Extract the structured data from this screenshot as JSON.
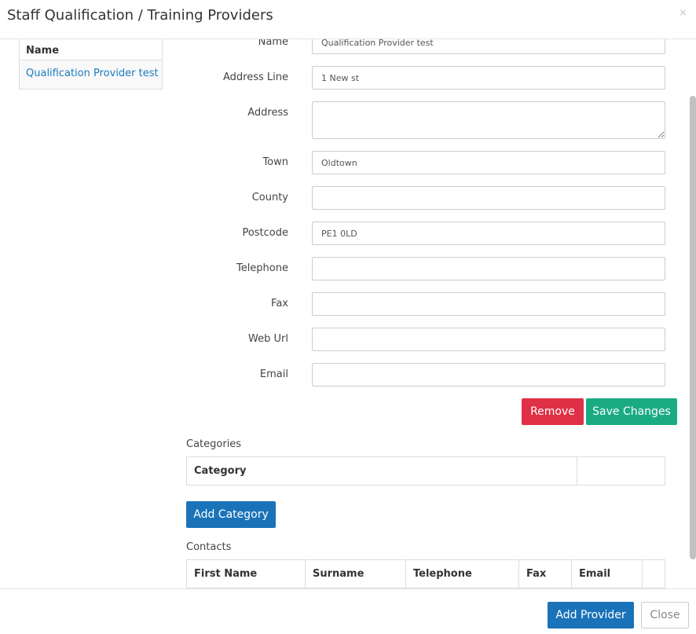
{
  "header": {
    "title": "Staff Qualification / Training Providers",
    "close_glyph": "×"
  },
  "provider_list": {
    "header": "Name",
    "items": [
      "Qualification Provider test"
    ]
  },
  "form": {
    "name": {
      "label": "Name",
      "value": "Qualification Provider test"
    },
    "address_line": {
      "label": "Address Line",
      "value": "1 New st"
    },
    "address": {
      "label": "Address",
      "value": ""
    },
    "town": {
      "label": "Town",
      "value": "Oldtown"
    },
    "county": {
      "label": "County",
      "value": ""
    },
    "postcode": {
      "label": "Postcode",
      "value": "PE1 0LD"
    },
    "telephone": {
      "label": "Telephone",
      "value": ""
    },
    "fax": {
      "label": "Fax",
      "value": ""
    },
    "web_url": {
      "label": "Web Url",
      "value": ""
    },
    "email": {
      "label": "Email",
      "value": ""
    },
    "remove_label": "Remove",
    "save_label": "Save Changes"
  },
  "categories": {
    "label": "Categories",
    "columns": [
      "Category",
      ""
    ],
    "add_label": "Add Category"
  },
  "contacts": {
    "label": "Contacts",
    "columns": [
      "First Name",
      "Surname",
      "Telephone",
      "Fax",
      "Email",
      ""
    ]
  },
  "footer": {
    "add_provider_label": "Add Provider",
    "close_label": "Close"
  },
  "colors": {
    "primary": "#1a73b8",
    "danger": "#e03045",
    "success": "#1bab82",
    "link": "#1a7bbf"
  }
}
